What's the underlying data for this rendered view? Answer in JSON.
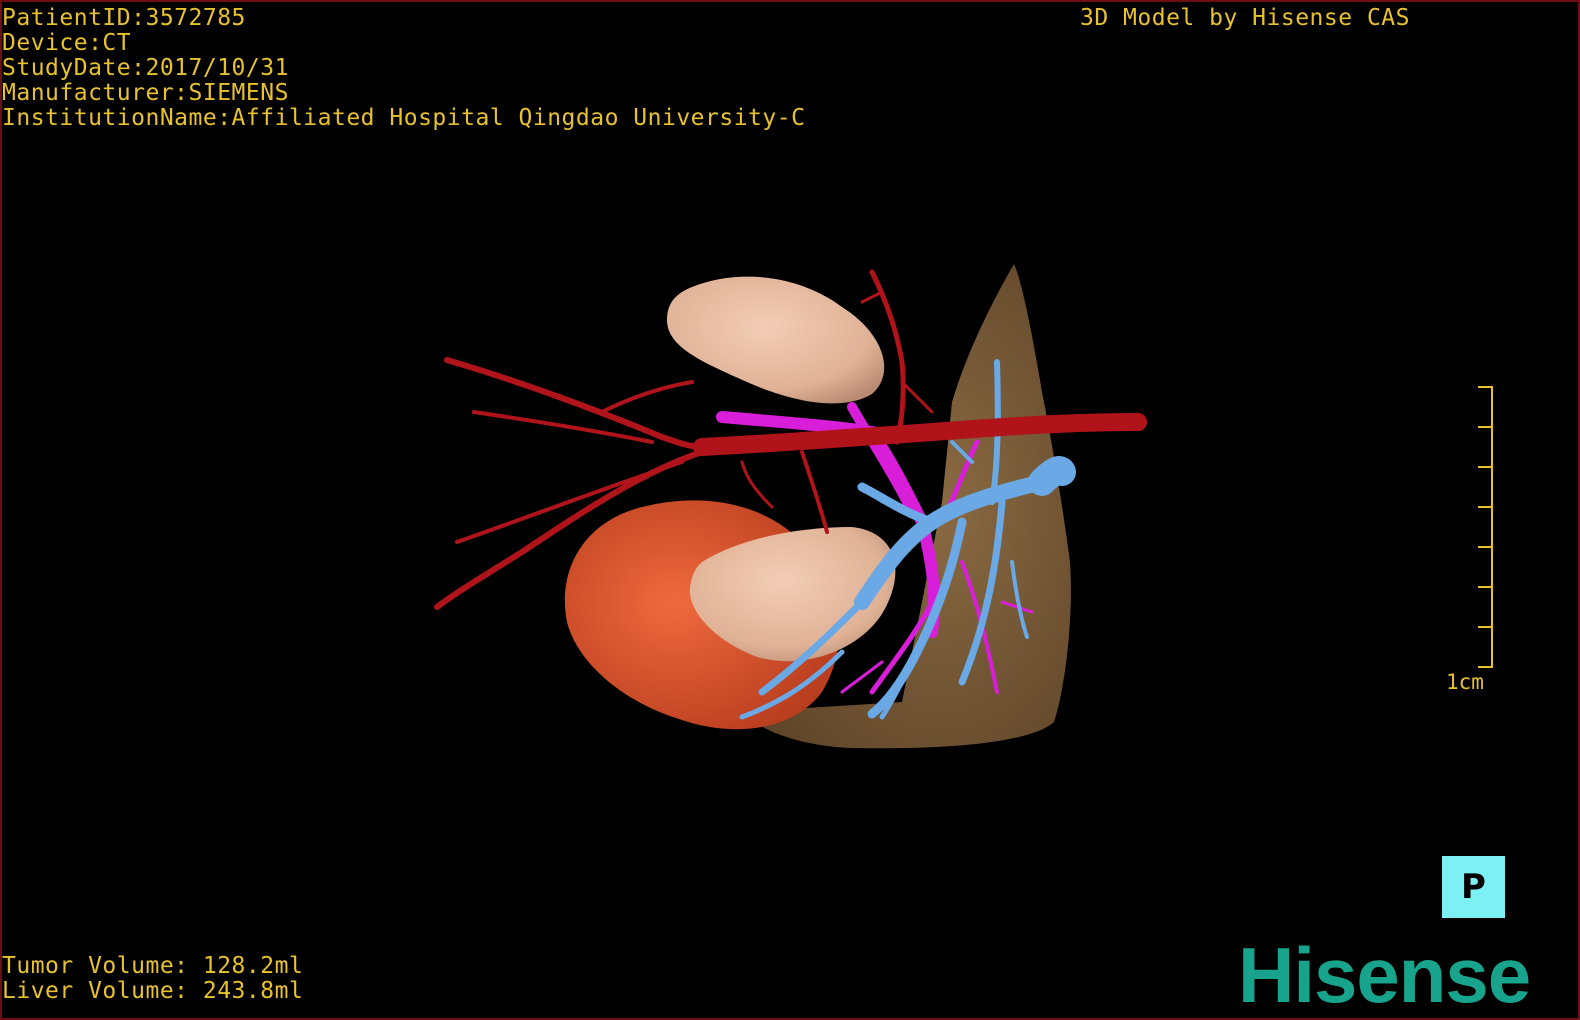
{
  "dicom": {
    "patient_id": "PatientID:3572785",
    "device": "Device:CT",
    "study_date": "StudyDate:2017/10/31",
    "manufacturer": "Manufacturer:SIEMENS",
    "institution": "InstitutionName:Affiliated Hospital Qingdao University-C"
  },
  "credit": "3D Model by Hisense CAS",
  "volumes": {
    "tumor": "Tumor Volume: 128.2ml",
    "liver": "Liver Volume: 243.8ml"
  },
  "scale": {
    "label": "1cm"
  },
  "orientation": {
    "letter": "P"
  },
  "brand": {
    "name": "Hisense",
    "color": "#18a38d"
  },
  "colors": {
    "overlay_text": "#e8c22e",
    "artery": "#b0141a",
    "portal_vein": "#6aa8e6",
    "hepatic_vein": "#d81ed8",
    "kidney": "#e3b89f",
    "tumor": "#e0502a",
    "liver": "#7a5a35",
    "orientation_cube": "#7df0f4"
  }
}
